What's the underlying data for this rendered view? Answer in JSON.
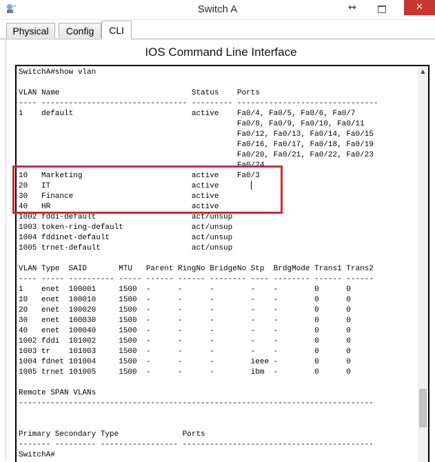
{
  "window": {
    "title": "Switch A",
    "app_icon": "packet-tracer-icon",
    "move_glyph": "↔",
    "close_glyph": "✕"
  },
  "tabs": [
    {
      "label": "Physical",
      "active": false
    },
    {
      "label": "Config",
      "active": false
    },
    {
      "label": "CLI",
      "active": true
    }
  ],
  "cli": {
    "title": "IOS Command Line Interface",
    "lines": [
      "SwitchA#show vlan",
      "",
      "VLAN Name                             Status    Ports",
      "---- -------------------------------- --------- -------------------------------",
      "1    default                          active    Fa0/4, Fa0/5, Fa0/6, Fa0/7",
      "                                                Fa0/8, Fa0/9, Fa0/10, Fa0/11",
      "                                                Fa0/12, Fa0/13, Fa0/14, Fa0/15",
      "                                                Fa0/16, Fa0/17, Fa0/18, Fa0/19",
      "                                                Fa0/20, Fa0/21, Fa0/22, Fa0/23",
      "                                                Fa0/24",
      "10   Marketing                        active    Fa0/3",
      "20   IT                               active",
      "30   Finance                          active",
      "40   HR                               active",
      "1002 fddi-default                     act/unsup",
      "1003 token-ring-default               act/unsup",
      "1004 fddinet-default                  act/unsup",
      "1005 trnet-default                    act/unsup",
      "",
      "VLAN Type  SAID       MTU   Parent RingNo BridgeNo Stp  BrdgMode Trans1 Trans2",
      "---- ----- ---------- ----- ------ ------ -------- ---- -------- ------ ------",
      "1    enet  100001     1500  -      -      -        -    -        0      0",
      "10   enet  100010     1500  -      -      -        -    -        0      0",
      "20   enet  100020     1500  -      -      -        -    -        0      0",
      "30   enet  100030     1500  -      -      -        -    -        0      0",
      "40   enet  100040     1500  -      -      -        -    -        0      0",
      "1002 fddi  101002     1500  -      -      -        -    -        0      0",
      "1003 tr    101003     1500  -      -      -        -    -        0      0",
      "1004 fdnet 101004     1500  -      -      -        ieee -        0      0",
      "1005 trnet 101005     1500  -      -      -        ibm  -        0      0",
      "",
      "Remote SPAN VLANs",
      "------------------------------------------------------------------------------",
      "",
      "",
      "Primary Secondary Type              Ports",
      "------- --------- ----------------- ------------------------------------------",
      "SwitchA#"
    ]
  },
  "highlight": {
    "color": "#cf2a32",
    "vlans": [
      "10",
      "20",
      "30",
      "40"
    ]
  }
}
